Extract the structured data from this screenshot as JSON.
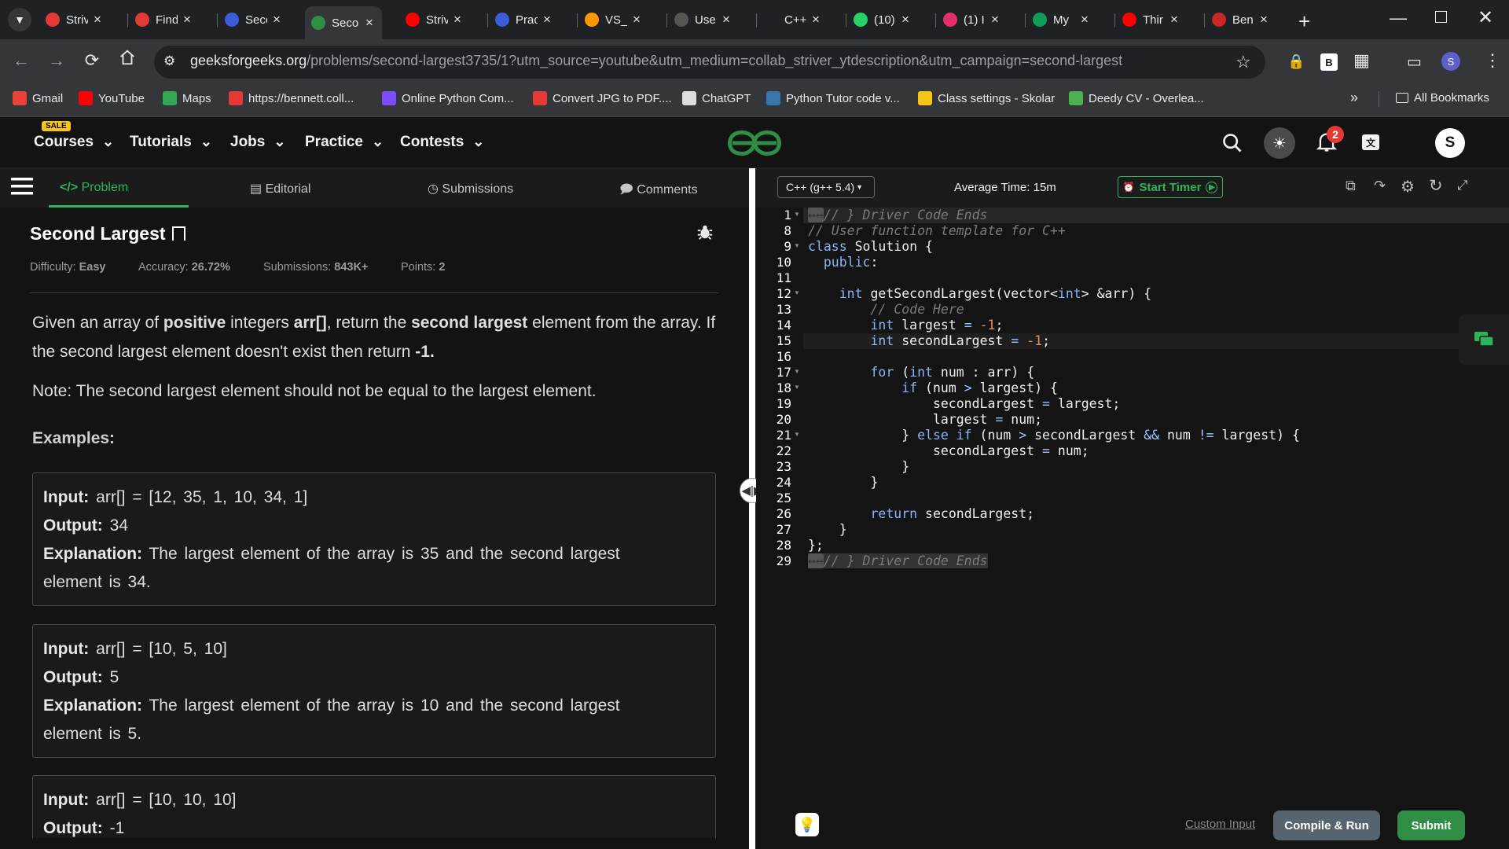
{
  "browser": {
    "tabs": [
      {
        "title": "Striv",
        "favicon": "tuf-icon",
        "color": "#e53935"
      },
      {
        "title": "Find",
        "favicon": "tuf-icon",
        "color": "#e53935"
      },
      {
        "title": "Seco",
        "favicon": "k-icon",
        "color": "#3b5bdb"
      },
      {
        "title": "Seco",
        "favicon": "gfg-icon",
        "color": "#2f8d46",
        "active": true
      },
      {
        "title": "Striv",
        "favicon": "youtube-icon",
        "color": "#ff0000"
      },
      {
        "title": "Prac",
        "favicon": "k-icon",
        "color": "#3b5bdb"
      },
      {
        "title": "VS_",
        "favicon": "lightning-icon",
        "color": "#ff9800"
      },
      {
        "title": "Use",
        "favicon": "chatgpt-icon",
        "color": "#555555"
      },
      {
        "title": "C++",
        "favicon": "blank-icon",
        "color": "#202124"
      },
      {
        "title": "(10)",
        "favicon": "whatsapp-icon",
        "color": "#25d366"
      },
      {
        "title": "(1) I",
        "favicon": "instagram-icon",
        "color": "#e1306c"
      },
      {
        "title": "My",
        "favicon": "sheets-icon",
        "color": "#0f9d58"
      },
      {
        "title": "Thir",
        "favicon": "youtube-icon",
        "color": "#ff0000"
      },
      {
        "title": "Ben",
        "favicon": "shield-icon",
        "color": "#c62828"
      }
    ],
    "url_host": "geeksforgeeks.org",
    "url_path": "/problems/second-largest3735/1?utm_source=youtube&utm_medium=collab_striver_ytdescription&utm_campaign=second-largest",
    "profile_initial": "S",
    "bookmarks": [
      {
        "label": "Gmail",
        "icon": "gmail-icon",
        "color": "#ea4335"
      },
      {
        "label": "YouTube",
        "icon": "youtube-icon",
        "color": "#ff0000"
      },
      {
        "label": "Maps",
        "icon": "maps-icon",
        "color": "#34a853"
      },
      {
        "label": "https://bennett.coll...",
        "icon": "chat-icon",
        "color": "#e53935"
      },
      {
        "label": "Online Python Com...",
        "icon": "lightning-icon",
        "color": "#7c4dff"
      },
      {
        "label": "Convert JPG to PDF....",
        "icon": "heart-icon",
        "color": "#e53935"
      },
      {
        "label": "ChatGPT",
        "icon": "chatgpt-icon",
        "color": "#dddddd"
      },
      {
        "label": "Python Tutor code v...",
        "icon": "python-icon",
        "color": "#3776ab"
      },
      {
        "label": "Class settings - Skolar",
        "icon": "skolar-icon",
        "color": "#f5c518"
      },
      {
        "label": "Deedy CV - Overlea...",
        "icon": "overleaf-icon",
        "color": "#4caf50"
      }
    ],
    "all_bookmarks": "All Bookmarks"
  },
  "gfg": {
    "nav": [
      "Courses",
      "Tutorials",
      "Jobs",
      "Practice",
      "Contests"
    ],
    "sale": "SALE",
    "notifications": "2",
    "user_initial": "S"
  },
  "problem": {
    "tabs": [
      "Problem",
      "Editorial",
      "Submissions",
      "Comments"
    ],
    "title": "Second Largest",
    "meta": [
      {
        "label": "Difficulty: ",
        "value": "Easy"
      },
      {
        "label": "Accuracy: ",
        "value": "26.72%"
      },
      {
        "label": "Submissions: ",
        "value": "843K+"
      },
      {
        "label": "Points: ",
        "value": "2"
      }
    ],
    "desc_1a": "Given an array of ",
    "desc_1b": "positive",
    "desc_1c": " integers ",
    "desc_1d": "arr[]",
    "desc_1e": ", return the ",
    "desc_1f": "second largest",
    "desc_1g": " element from the array. If",
    "desc_2a": "the second largest element doesn't exist then return ",
    "desc_2b": "-1.",
    "note": "Note: The second largest element should not be equal to the largest element.",
    "examples_label": "Examples:",
    "input_label": "Input:",
    "output_label": "Output:",
    "explanation_label": "Explanation:",
    "examples": [
      {
        "input": "arr[] = [12, 35, 1, 10, 34, 1]",
        "output": "34",
        "exp1": "The largest element of the array is 35 and the second largest",
        "exp2": "element is 34."
      },
      {
        "input": "arr[] = [10, 5, 10]",
        "output": "5",
        "exp1": "The largest element of the array is 10 and the second largest",
        "exp2": "element is 5."
      },
      {
        "input": "arr[] = [10, 10, 10]",
        "output": "-1"
      }
    ]
  },
  "editor": {
    "language": "C++ (g++ 5.4)",
    "avg_time": "Average Time: 15m",
    "start_timer": "Start Timer",
    "line_numbers": [
      "1",
      "8",
      "9",
      "10",
      "11",
      "12",
      "13",
      "14",
      "15",
      "16",
      "17",
      "18",
      "19",
      "20",
      "21",
      "22",
      "23",
      "24",
      "25",
      "26",
      "27",
      "28",
      "29"
    ],
    "custom_input": "Custom Input",
    "compile_run": "Compile & Run",
    "submit": "Submit"
  }
}
